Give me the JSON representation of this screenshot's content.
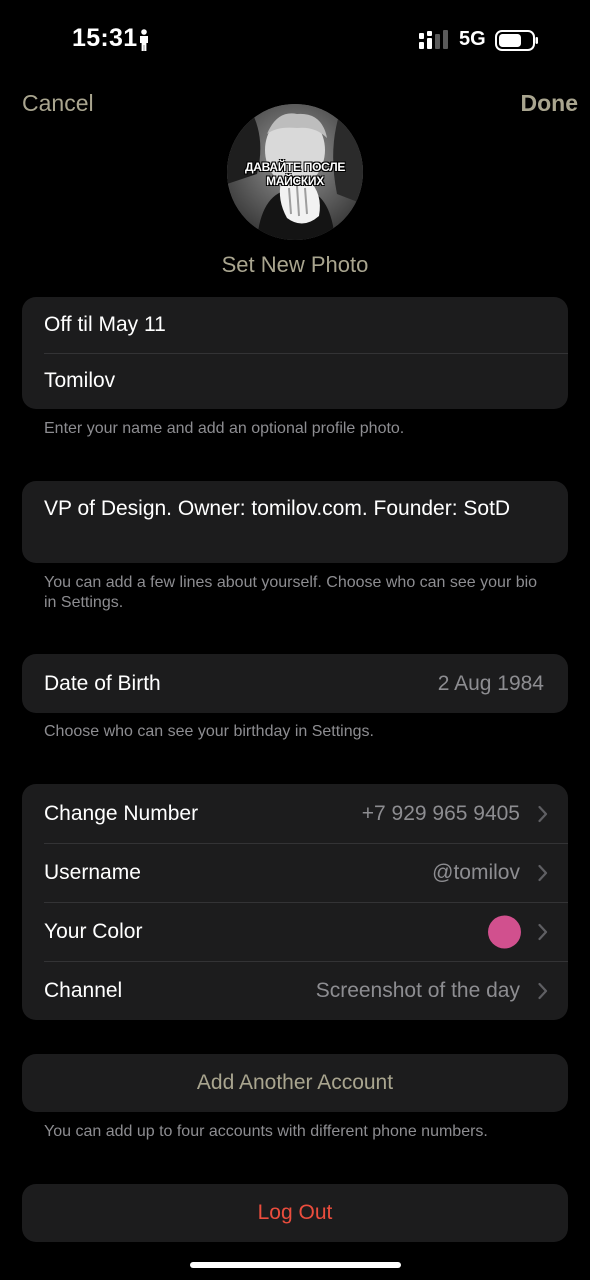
{
  "status_bar": {
    "time": "15:31",
    "network": "5G",
    "icons": [
      "person-icon",
      "signal-icon",
      "battery-icon"
    ]
  },
  "nav": {
    "cancel": "Cancel",
    "done": "Done",
    "set_photo": "Set New Photo",
    "avatar_caption": "ДАВАЙТЕ ПОСЛЕ МАЙСКИХ"
  },
  "name_section": {
    "first_name": "Off til May 11",
    "last_name": "Tomilov",
    "footer": "Enter your name and add an optional profile photo."
  },
  "bio_section": {
    "bio": "VP of Design. Owner: tomilov.com. Founder: SotD",
    "footer": "You can add a few lines about yourself. Choose who can see your bio in Settings."
  },
  "birthday_section": {
    "label": "Date of Birth",
    "value": "2 Aug 1984",
    "footer": "Choose who can see your birthday in Settings."
  },
  "account_rows": [
    {
      "label": "Change Number",
      "value": "+7 929 965 9405"
    },
    {
      "label": "Username",
      "value": "@tomilov"
    },
    {
      "label": "Your Color",
      "value": ""
    },
    {
      "label": "Channel",
      "value": "Screenshot of the day"
    }
  ],
  "profile_color": "#d1508e",
  "add_account": {
    "label": "Add Another Account",
    "footer": "You can add up to four accounts with different phone numbers."
  },
  "logout": {
    "label": "Log Out"
  },
  "colors": {
    "accent": "#a9a58f",
    "destructive": "#eb4d3d",
    "cell_background": "#1c1c1d",
    "secondary_text": "#8d8d91"
  }
}
